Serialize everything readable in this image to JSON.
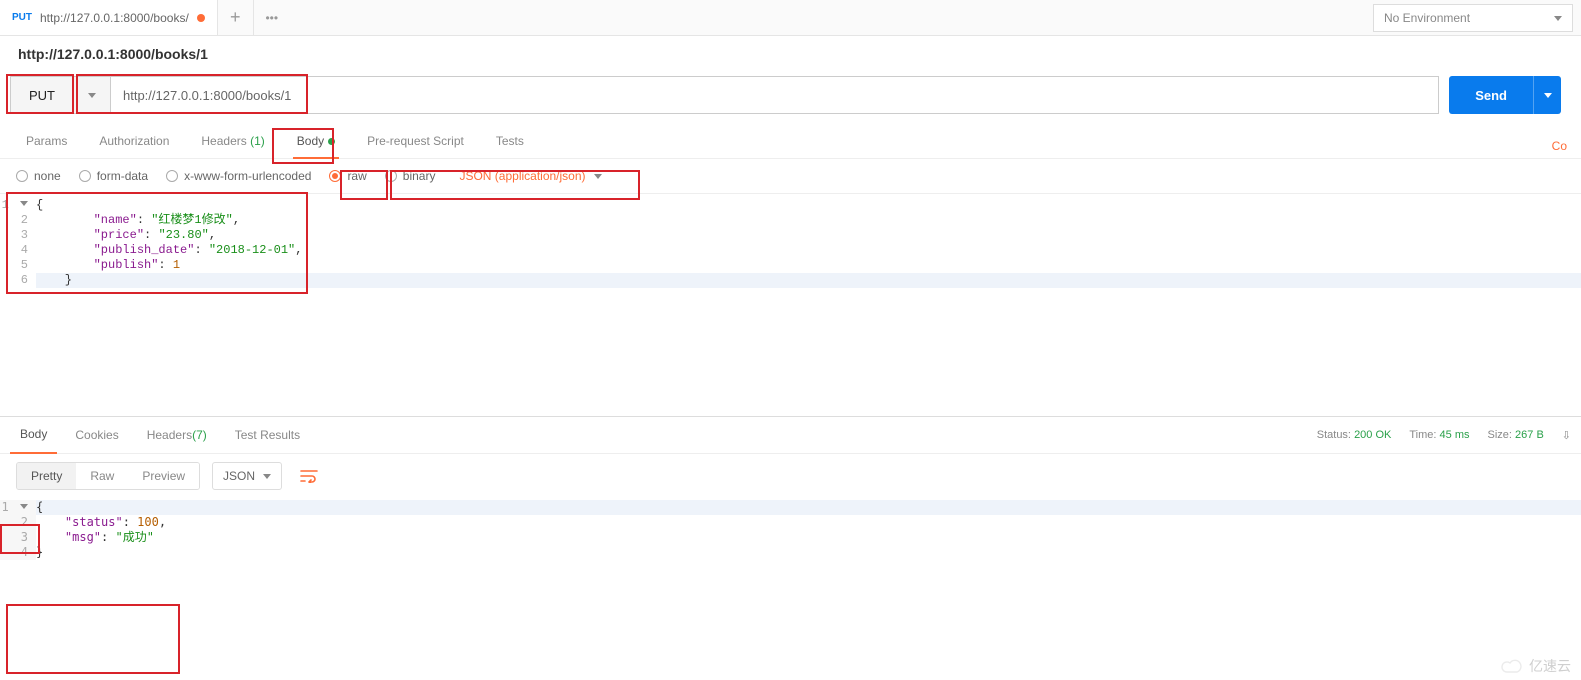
{
  "top_tab": {
    "method": "PUT",
    "title": "http://127.0.0.1:8000/books/",
    "dirty": true
  },
  "environment": {
    "selected": "No Environment"
  },
  "request_name": "http://127.0.0.1:8000/books/1",
  "method": {
    "value": "PUT"
  },
  "url": {
    "value": "http://127.0.0.1:8000/books/1"
  },
  "send_button": "Send",
  "request_tabs": {
    "params": "Params",
    "authorization": "Authorization",
    "headers": "Headers",
    "headers_count": "(1)",
    "body": "Body",
    "prereq": "Pre-request Script",
    "tests": "Tests",
    "right_link": "Co"
  },
  "body_types": {
    "none": "none",
    "form_data": "form-data",
    "urlencoded": "x-www-form-urlencoded",
    "raw": "raw",
    "binary": "binary",
    "content_type": "JSON (application/json)"
  },
  "request_body_json": {
    "name": "红楼梦1修改",
    "price": "23.80",
    "publish_date": "2018-12-01",
    "publish": 1
  },
  "request_body_lines": {
    "l1": "{",
    "l2_key": "\"name\"",
    "l2_sep": ": ",
    "l2_val": "\"红楼梦1修改\"",
    "l2_end": ",",
    "l3_key": "\"price\"",
    "l3_sep": ": ",
    "l3_val": "\"23.80\"",
    "l3_end": ",",
    "l4_key": "\"publish_date\"",
    "l4_sep": ": ",
    "l4_val": "\"2018-12-01\"",
    "l4_end": ",",
    "l5_key": "\"publish\"",
    "l5_sep": ": ",
    "l5_val": "1",
    "l6": "    }"
  },
  "response_tabs": {
    "body": "Body",
    "cookies": "Cookies",
    "headers": "Headers",
    "headers_count": "(7)",
    "tests": "Test Results"
  },
  "response_meta": {
    "status_label": "Status:",
    "status_value": "200 OK",
    "time_label": "Time:",
    "time_value": "45 ms",
    "size_label": "Size:",
    "size_value": "267 B"
  },
  "response_toolbar": {
    "pretty": "Pretty",
    "raw": "Raw",
    "preview": "Preview",
    "lang": "JSON"
  },
  "response_body_json": {
    "status": 100,
    "msg": "成功"
  },
  "response_body_lines": {
    "l1": "{",
    "l2_key": "\"status\"",
    "l2_sep": ": ",
    "l2_val": "100",
    "l2_end": ",",
    "l3_key": "\"msg\"",
    "l3_sep": ": ",
    "l3_val": "\"成功\"",
    "l4": "}"
  },
  "watermark": "亿速云"
}
